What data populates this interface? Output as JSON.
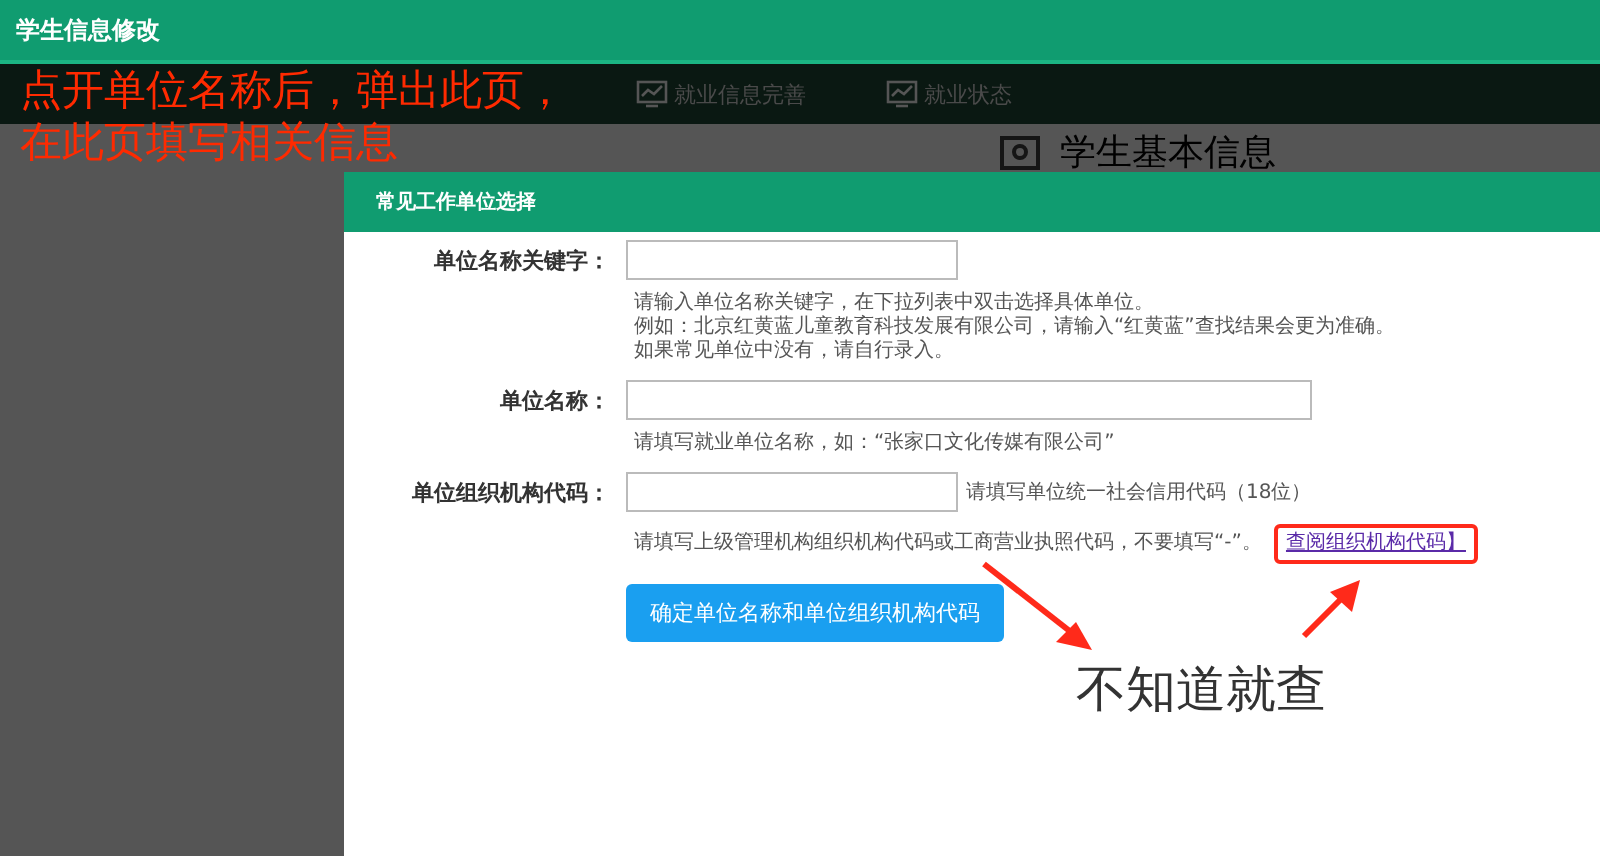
{
  "window": {
    "title": "学生信息修改"
  },
  "tabs": [
    {
      "label": "就业信息完善"
    },
    {
      "label": "就业状态"
    }
  ],
  "background_heading": "学生基本信息",
  "dialog": {
    "title": "常见工作单位选择",
    "fields": [
      {
        "label": "单位名称关键字：",
        "kind": "keyword",
        "help": [
          "请输入单位名称关键字，在下拉列表中双击选择具体单位。",
          "例如：北京红黄蓝儿童教育科技发展有限公司，请输入“红黄蓝”查找结果会更为准确。",
          "如果常见单位中没有，请自行录入。"
        ]
      },
      {
        "label": "单位名称：",
        "kind": "name",
        "help": [
          "请填写就业单位名称，如：“张家口文化传媒有限公司”"
        ]
      },
      {
        "label": "单位组织机构代码：",
        "kind": "code",
        "hint": "请填写单位统一社会信用代码（18位）",
        "help": [
          "请填写上级管理机构组织机构代码或工商营业执照代码，不要填写“-”。"
        ],
        "link": "查阅组织机构代码】"
      }
    ],
    "button": "确定单位名称和单位组织机构代码"
  },
  "annotations": {
    "note_top": [
      "点开单位名称后，弹出此页，",
      "在此页填写相关信息"
    ],
    "note_bottom": "不知道就查"
  }
}
